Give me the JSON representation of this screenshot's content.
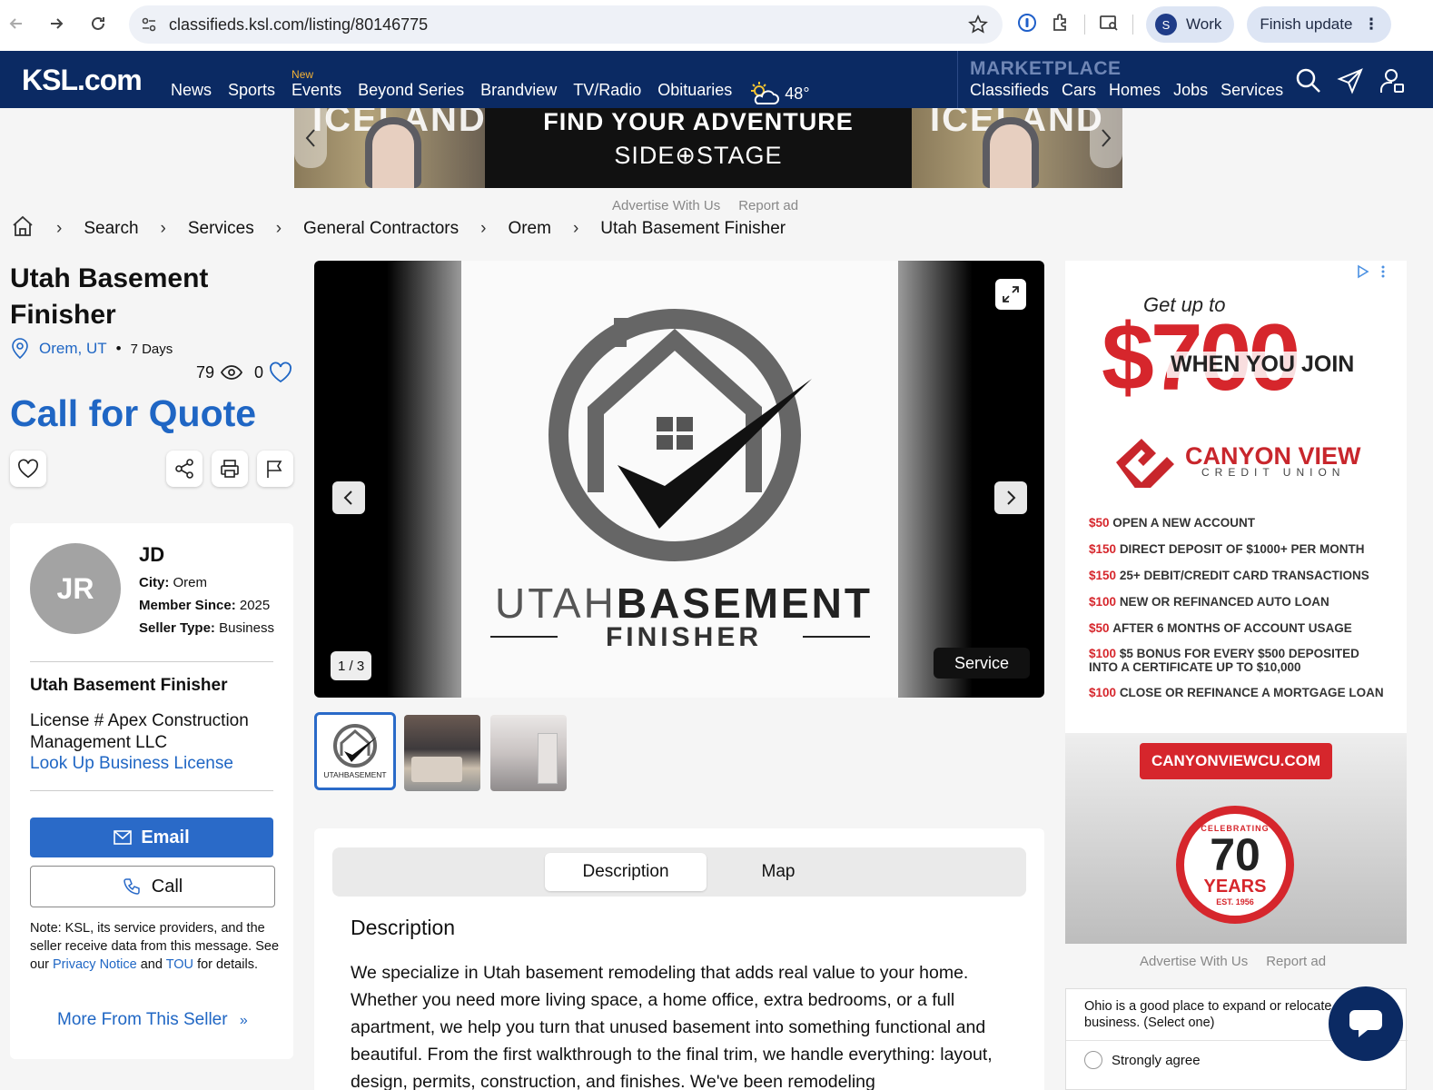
{
  "browser": {
    "url": "classifieds.ksl.com/listing/80146775",
    "profile_initial": "S",
    "profile_label": "Work",
    "update_label": "Finish update"
  },
  "site": {
    "logo": "KSL.com",
    "nav": [
      "News",
      "Sports",
      "Events",
      "Beyond Series",
      "Brandview",
      "TV/Radio",
      "Obituaries"
    ],
    "new_badge": "New",
    "temperature": "48°",
    "marketplace_title": "MARKETPLACE",
    "marketplace_nav": [
      "Classifieds",
      "Cars",
      "Homes",
      "Jobs",
      "Services"
    ]
  },
  "banner_ad": {
    "side_text": "ICELAND",
    "headline": "FIND YOUR ADVENTURE",
    "brand": "SIDE⊕STAGE"
  },
  "ad_links": {
    "advertise": "Advertise With Us",
    "report": "Report ad"
  },
  "breadcrumb": [
    "Search",
    "Services",
    "General Contractors",
    "Orem",
    "Utah Basement Finisher"
  ],
  "listing": {
    "title": "Utah Basement Finisher",
    "location": "Orem, UT",
    "age": "7 Days",
    "views": "79",
    "favorites": "0",
    "price": "Call for Quote"
  },
  "seller": {
    "initials": "JR",
    "name": "JD",
    "city_label": "City:",
    "city": "Orem",
    "member_label": "Member Since:",
    "member_since": "2025",
    "type_label": "Seller Type:",
    "type": "Business",
    "business_name": "Utah Basement Finisher",
    "license": "License # Apex Construction Management LLC",
    "lookup_link": "Look Up Business License",
    "email_label": "Email",
    "call_label": "Call",
    "note_prefix": "Note: KSL, its service providers, and the seller receive data from this message. See our",
    "privacy_link": "Privacy Notice",
    "note_and": "and",
    "tou_link": "TOU",
    "note_suffix": "for details.",
    "more_link": "More From This Seller"
  },
  "gallery": {
    "counter": "1 / 3",
    "type_badge": "Service",
    "logo_word_light": "UTAH",
    "logo_word_bold": "BASEMENT",
    "logo_sub": "FINISHER",
    "thumb_logo_text": "UTAHBASEMENT"
  },
  "tabs": [
    "Description",
    "Map"
  ],
  "description": {
    "heading": "Description",
    "text": "We specialize in Utah basement remodeling that adds real value to your home. Whether you need more living space, a home office, extra bedrooms, or a full apartment, we help you turn that unused basement into something functional and beautiful. From the first walkthrough to the final trim, we handle everything: layout, design, permits, construction, and finishes. We've been remodeling"
  },
  "side_ad": {
    "get_up": "Get up to",
    "amount": "$700",
    "when_join": "WHEN YOU JOIN",
    "brand": "CANYON VIEW",
    "sub": "CREDIT UNION",
    "items": [
      {
        "amt": "$50",
        "text": "OPEN A NEW ACCOUNT"
      },
      {
        "amt": "$150",
        "text": "DIRECT DEPOSIT OF $1000+ PER MONTH"
      },
      {
        "amt": "$150",
        "text": "25+ DEBIT/CREDIT CARD TRANSACTIONS"
      },
      {
        "amt": "$100",
        "text": "NEW OR REFINANCED AUTO LOAN"
      },
      {
        "amt": "$50",
        "text": "AFTER 6 MONTHS OF ACCOUNT USAGE"
      },
      {
        "amt": "$100",
        "text": "$5 BONUS FOR EVERY $500 DEPOSITED INTO A CERTIFICATE UP TO $10,000"
      },
      {
        "amt": "$100",
        "text": "CLOSE OR REFINANCE A MORTGAGE LOAN"
      }
    ],
    "url": "CANYONVIEWCU.COM",
    "seal_top": "CELEBRATING",
    "seal_num": "70",
    "seal_years": "YEARS",
    "seal_est": "EST. 1956"
  },
  "survey": {
    "question": "Ohio is a good place to expand or relocate business. (Select one)",
    "option": "Strongly agree"
  },
  "colors": {
    "ksl_navy": "#0b2a63",
    "link_blue": "#1f66c4",
    "ad_red": "#d6262c"
  }
}
